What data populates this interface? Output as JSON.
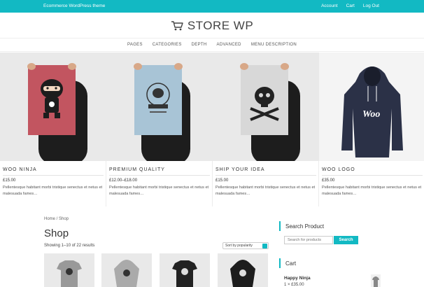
{
  "topbar": {
    "tagline": "Ecommerce WordPress theme",
    "links": [
      "Account",
      "Cart",
      "Log Out"
    ]
  },
  "logo": {
    "text": "STORE WP",
    "icon": "cart-icon"
  },
  "nav": {
    "items": [
      "PAGES",
      "CATEGORIES",
      "DEPTH",
      "ADVANCED",
      "MENU DESCRIPTION"
    ]
  },
  "products": [
    {
      "title": "WOO NINJA",
      "price": "£15.00",
      "description": "Pellentesque habitant morbi tristique senectus et netus et malesuada fames…",
      "image": "ninja-poster"
    },
    {
      "title": "PREMIUM QUALITY",
      "price": "£12.00–£18.00",
      "description": "Pellentesque habitant morbi tristique senectus et netus et malesuada fames…",
      "image": "woothemes-poster"
    },
    {
      "title": "SHIP YOUR IDEA",
      "price": "£15.00",
      "description": "Pellentesque habitant morbi tristique senectus et netus et malesuada fames…",
      "image": "skull-poster"
    },
    {
      "title": "WOO LOGO",
      "price": "£35.00",
      "description": "Pellentesque habitant morbi tristique senectus et netus et malesuada fames…",
      "image": "woo-hoodie"
    }
  ],
  "shop": {
    "breadcrumb": "Home / Shop",
    "title": "Shop",
    "results": "Showing 1–10 of 22 results",
    "sort": "Sort by popularity"
  },
  "sidebar": {
    "search_title": "Search Product",
    "search_placeholder": "Search for products",
    "search_button": "Search",
    "cart_title": "Cart",
    "cart_item": "Happy Ninja",
    "cart_qty": "1 × £35.00"
  },
  "colors": {
    "accent": "#12b9c3",
    "poster_red": "#c25560",
    "poster_blue": "#a8c4d6",
    "hoodie_navy": "#2b3147"
  }
}
